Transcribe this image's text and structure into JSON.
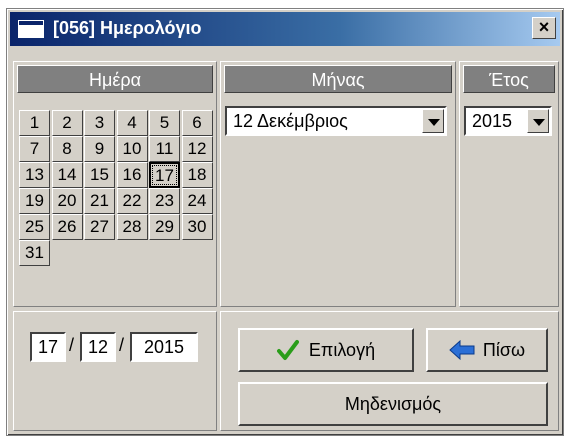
{
  "window": {
    "title": "[056] Ημερολόγιο",
    "close_label": "×"
  },
  "headers": {
    "day": "Ημέρα",
    "month": "Μήνας",
    "year": "Έτος"
  },
  "days": [
    "1",
    "2",
    "3",
    "4",
    "5",
    "6",
    "7",
    "8",
    "9",
    "10",
    "11",
    "12",
    "13",
    "14",
    "15",
    "16",
    "17",
    "18",
    "19",
    "20",
    "21",
    "22",
    "23",
    "24",
    "25",
    "26",
    "27",
    "28",
    "29",
    "30",
    "31"
  ],
  "selected_day": "17",
  "month_select": {
    "value": "12 Δεκέμβριος"
  },
  "year_select": {
    "value": "2015"
  },
  "date_fields": {
    "day": "17",
    "month": "12",
    "year": "2015",
    "separator": "/"
  },
  "buttons": {
    "select": "Επιλογή",
    "back": "Πίσω",
    "reset": "Μηδενισμός"
  },
  "colors": {
    "face": "#d4d0c8",
    "header": "#808080",
    "title_start": "#0a246a",
    "check": "#2a9d1a",
    "arrow": "#2b6fd6"
  },
  "icons": {
    "select": "check-icon",
    "back": "arrow-left-icon"
  }
}
